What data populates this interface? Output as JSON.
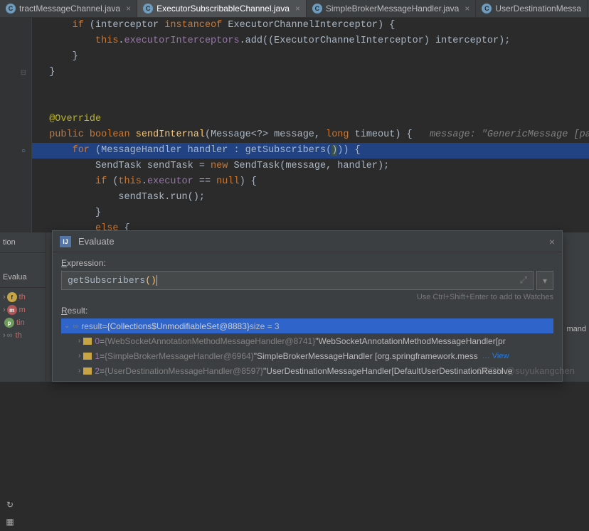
{
  "tabs": [
    {
      "label": "tractMessageChannel.java",
      "active": false
    },
    {
      "label": "ExecutorSubscribableChannel.java",
      "active": true
    },
    {
      "label": "SimpleBrokerMessageHandler.java",
      "active": false
    },
    {
      "label": "UserDestinationMessa",
      "active": false
    }
  ],
  "code": {
    "l0": {
      "if": "if",
      "open": "(",
      "var": "interceptor",
      "inst": "instanceof",
      "type": "ExecutorChannelInterceptor",
      "close": ") {"
    },
    "l1": {
      "this": "this",
      "dot": ".",
      "field": "executorInterceptors",
      "call": ".add((ExecutorChannelInterceptor) interceptor);"
    },
    "l2": "}",
    "l3": "}",
    "l4": "",
    "l5": "",
    "ann": "@Override",
    "sig": {
      "pub": "public",
      "bool": "boolean",
      "name": "sendInternal",
      "args": "(Message<?> message, ",
      "long": "long",
      "args2": " timeout) {",
      "hint": "   message: \"GenericMessage [payloa"
    },
    "for": {
      "for": "for",
      "open": " (",
      "args": "MessageHandler handler : getSubscribers(",
      "close": ")) {"
    },
    "l9": {
      "type": "SendTask",
      "var": " sendTask = ",
      "new": "new",
      "ctor": " SendTask",
      "args": "(message, handler);"
    },
    "l10": {
      "if": "if",
      "open": " (",
      "this": "this",
      "dot": ".",
      "field": "executor",
      "eq": " == ",
      "null": "null",
      "close": ") {"
    },
    "l11": "sendTask.run();",
    "l12": "}",
    "l13": {
      "else": "else",
      "brace": " {"
    }
  },
  "leftPanel": {
    "tab": "tion",
    "evalTab": "Evalua",
    "items": [
      {
        "icon": "f",
        "label": "th"
      },
      {
        "icon": "m",
        "label": "m"
      },
      {
        "icon": "p",
        "label": "tin"
      },
      {
        "icon": "f",
        "label": "th"
      }
    ]
  },
  "dialog": {
    "title": "Evaluate",
    "exprLabel": "Expression:",
    "exprValue": "getSubscribers",
    "parens": "()",
    "hint": "Use Ctrl+Shift+Enter to add to Watches",
    "resultLabel": "Result:",
    "result": {
      "root": {
        "name": "result",
        "value": "{Collections$UnmodifiableSet@8883}",
        "size": "  size = 3"
      },
      "items": [
        {
          "idx": "0",
          "cls": "{WebSocketAnnotationMethodMessageHandler@8741}",
          "str": "\"WebSocketAnnotationMethodMessageHandler[pr"
        },
        {
          "idx": "1",
          "cls": "{SimpleBrokerMessageHandler@6964}",
          "str": "\"SimpleBrokerMessageHandler [org.springframework.mess",
          "view": "… View"
        },
        {
          "idx": "2",
          "cls": "{UserDestinationMessageHandler@8597}",
          "str": "\"UserDestinationMessageHandler[DefaultUserDestinationResolve"
        }
      ]
    }
  },
  "rightText": "mand",
  "watermark": "CSDN @suyukangchen"
}
